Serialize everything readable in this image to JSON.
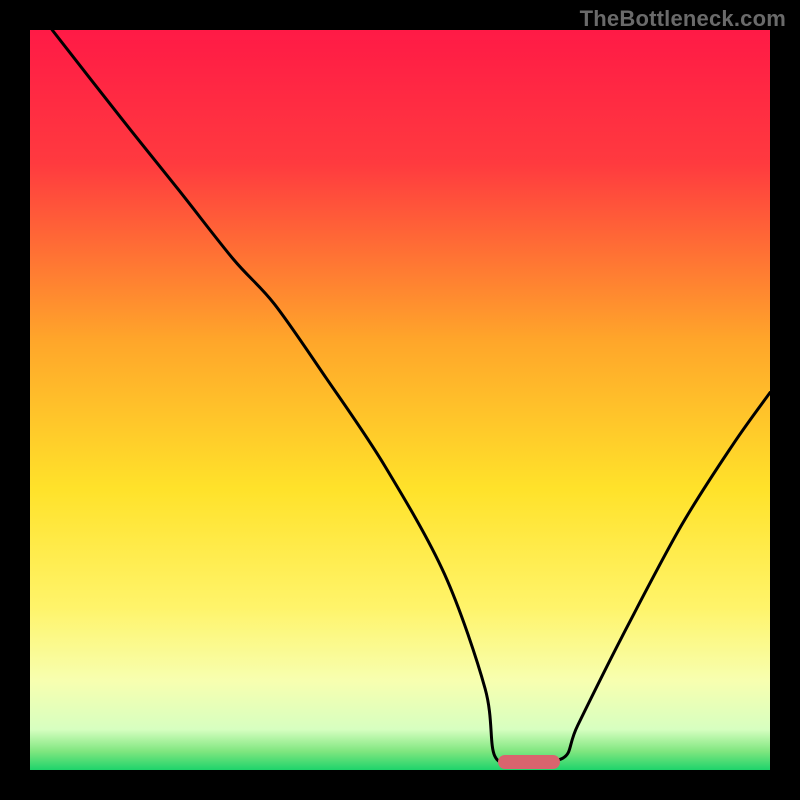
{
  "watermark": "TheBottleneck.com",
  "gradient_stops": [
    {
      "offset": 0.0,
      "color": "#ff1a46"
    },
    {
      "offset": 0.18,
      "color": "#ff3a3f"
    },
    {
      "offset": 0.42,
      "color": "#ffa62a"
    },
    {
      "offset": 0.62,
      "color": "#ffe22a"
    },
    {
      "offset": 0.78,
      "color": "#fff46a"
    },
    {
      "offset": 0.88,
      "color": "#f7ffb0"
    },
    {
      "offset": 0.945,
      "color": "#d7ffc0"
    },
    {
      "offset": 0.975,
      "color": "#7fe67f"
    },
    {
      "offset": 1.0,
      "color": "#1ed46b"
    }
  ],
  "marker": {
    "left_frac": 0.632,
    "right_frac": 0.716,
    "color": "#d9646e"
  },
  "chart_data": {
    "type": "line",
    "title": "",
    "xlabel": "",
    "ylabel": "",
    "xlim": [
      0,
      100
    ],
    "ylim": [
      0,
      100
    ],
    "notch": {
      "left": 62.8,
      "right": 72.0
    },
    "series": [
      {
        "name": "curve",
        "x": [
          3.0,
          12.0,
          20.0,
          27.5,
          33.0,
          40.0,
          48.0,
          56.0,
          61.5,
          62.8,
          66.0,
          72.0,
          74.0,
          80.0,
          88.0,
          95.0,
          100.0
        ],
        "y": [
          100.0,
          88.5,
          78.5,
          69.0,
          63.0,
          53.0,
          41.0,
          26.5,
          11.0,
          1.9,
          1.3,
          1.6,
          6.0,
          18.0,
          33.0,
          44.0,
          51.0
        ]
      }
    ]
  }
}
